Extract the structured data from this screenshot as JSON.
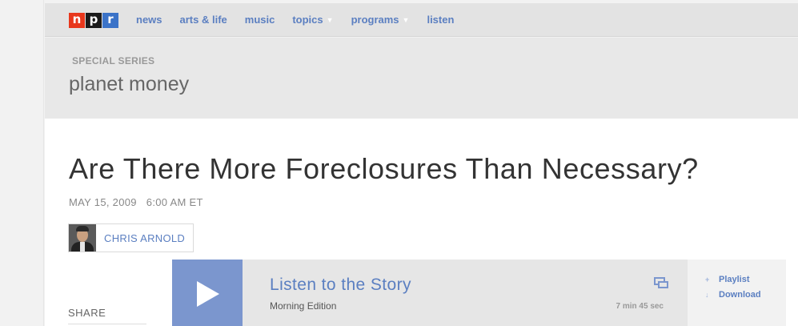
{
  "logo": {
    "letters": [
      "n",
      "p",
      "r"
    ]
  },
  "nav": {
    "items": [
      {
        "label": "news",
        "has_menu": false
      },
      {
        "label": "arts & life",
        "has_menu": false
      },
      {
        "label": "music",
        "has_menu": false
      },
      {
        "label": "topics",
        "has_menu": true
      },
      {
        "label": "programs",
        "has_menu": true
      },
      {
        "label": "listen",
        "has_menu": false
      }
    ]
  },
  "series": {
    "kicker": "SPECIAL SERIES",
    "title": "planet money"
  },
  "story": {
    "headline": "Are There More Foreclosures Than Necessary?",
    "date": "MAY 15, 2009",
    "time": "6:00 AM ET",
    "byline": "CHRIS ARNOLD"
  },
  "player": {
    "title": "Listen to the Story",
    "program": "Morning Edition",
    "duration": "7 min 45 sec",
    "actions": {
      "playlist": "Playlist",
      "download": "Download"
    },
    "icons": {
      "play": "play-icon",
      "popout": "popout-icon",
      "playlist": "plus-icon",
      "download": "download-arrow-icon"
    }
  },
  "share": {
    "label": "SHARE"
  },
  "colors": {
    "accent": "#5b7fc1",
    "play_button": "#7b96ce",
    "logo_n": "#e8371c",
    "logo_p": "#1b1b1b",
    "logo_r": "#3b73c8"
  }
}
